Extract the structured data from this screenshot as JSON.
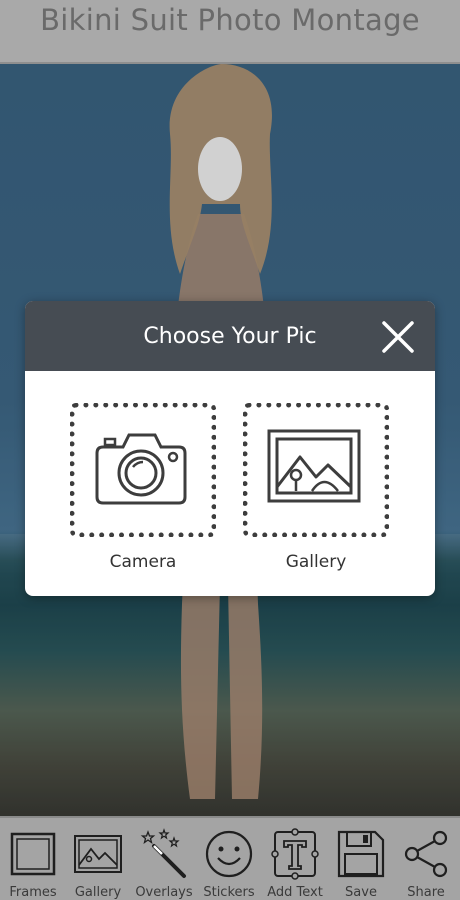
{
  "header": {
    "title": "Bikini Suit Photo Montage"
  },
  "dialog": {
    "title": "Choose Your Pic",
    "options": [
      {
        "label": "Camera",
        "icon": "camera-icon"
      },
      {
        "label": "Gallery",
        "icon": "image-icon"
      }
    ],
    "close_icon": "close-icon"
  },
  "toolbar": {
    "items": [
      {
        "label": "Frames",
        "icon": "frame-icon"
      },
      {
        "label": "Gallery",
        "icon": "image-icon"
      },
      {
        "label": "Overlays",
        "icon": "magic-wand-icon"
      },
      {
        "label": "Stickers",
        "icon": "smiley-icon"
      },
      {
        "label": "Add Text",
        "icon": "text-icon"
      },
      {
        "label": "Save",
        "icon": "floppy-disk-icon"
      },
      {
        "label": "Share",
        "icon": "share-icon"
      }
    ]
  },
  "colors": {
    "header_bg": "#a9a9a9",
    "dialog_header_bg": "#464c53",
    "toolbar_bg": "#a4a4a4",
    "sky": "#416d8e",
    "sea": "#224e58"
  }
}
